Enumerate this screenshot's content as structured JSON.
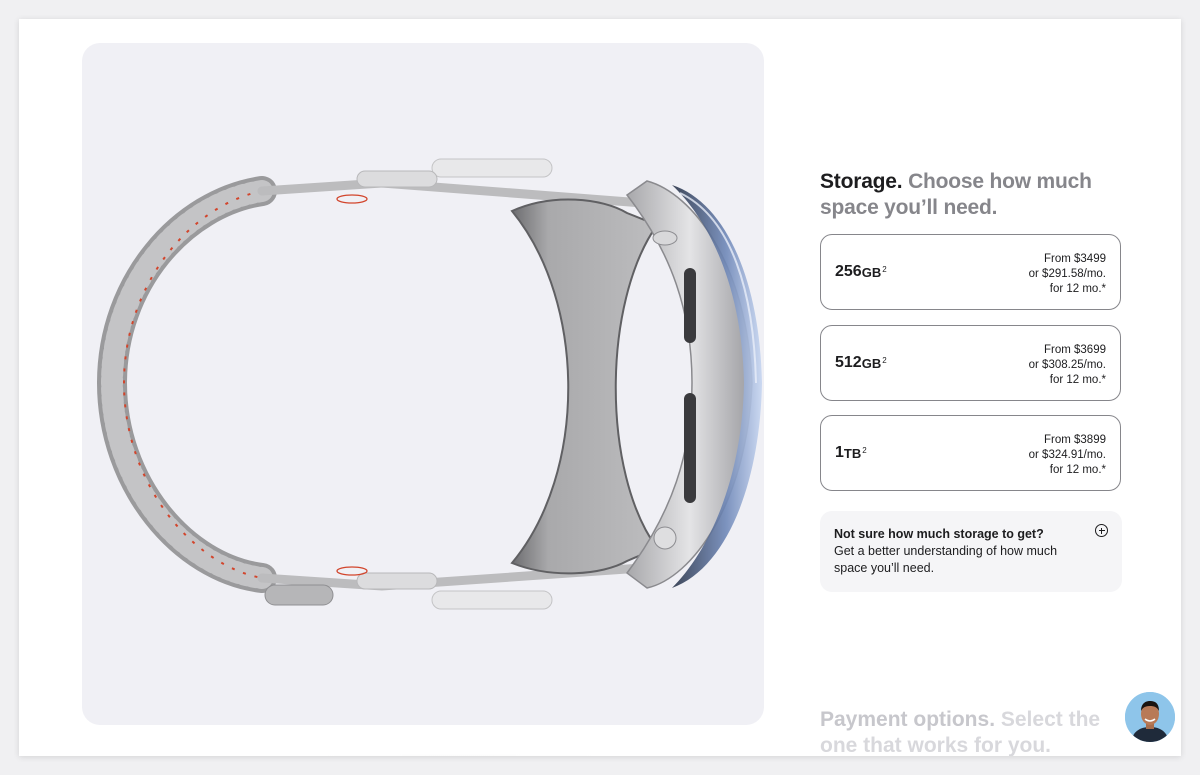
{
  "storage": {
    "title": "Storage.",
    "subtitle": "Choose how much space you’ll need.",
    "options": [
      {
        "capacity": "256",
        "unit": "GB",
        "footnote": "2",
        "price_from": "From $3499",
        "price_monthly": "or $291.58/mo.",
        "price_term": "for 12 mo.*"
      },
      {
        "capacity": "512",
        "unit": "GB",
        "footnote": "2",
        "price_from": "From $3699",
        "price_monthly": "or $308.25/mo.",
        "price_term": "for 12 mo.*"
      },
      {
        "capacity": "1",
        "unit": "TB",
        "footnote": "2",
        "price_from": "From $3899",
        "price_monthly": "or $324.91/mo.",
        "price_term": "for 12 mo.*"
      }
    ],
    "help": {
      "question": "Not sure how much storage to get?",
      "answer": "Get a better understanding of how much space you’ll need."
    }
  },
  "payment": {
    "title": "Payment options.",
    "subtitle": "Select the one that works for you."
  },
  "icons": {
    "help_expand": "plus-circle-icon",
    "avatar": "user-avatar"
  },
  "colors": {
    "text": "#1d1d1f",
    "muted": "#86868b",
    "panel_bg": "#f0f0f5",
    "card_border": "#86868b"
  }
}
